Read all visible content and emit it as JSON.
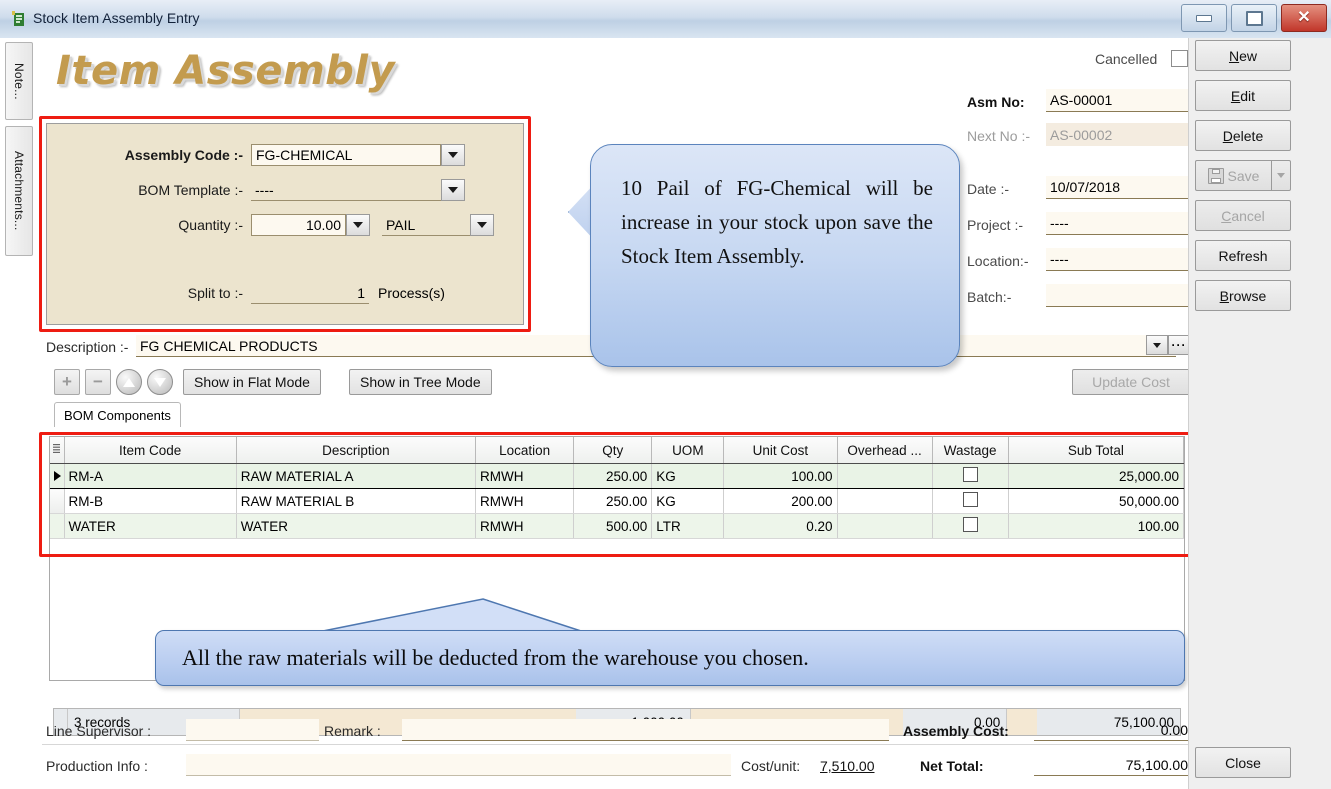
{
  "window": {
    "title": "Stock Item Assembly Entry",
    "icon": "app-icon",
    "minimize": "minimize-icon",
    "restore": "restore-icon",
    "close": "close-icon"
  },
  "side_tabs": [
    {
      "label": "Note...",
      "name": "note"
    },
    {
      "label": "Attachments...",
      "name": "attachments"
    }
  ],
  "page_title": "Item Assembly",
  "assembly_panel": {
    "assembly_code": {
      "label": "Assembly Code :-",
      "value": "FG-CHEMICAL"
    },
    "bom_template": {
      "label": "BOM Template :-",
      "value": "----"
    },
    "quantity": {
      "label": "Quantity :-",
      "value": "10.00",
      "uom": "PAIL"
    },
    "split_to": {
      "label": "Split to :-",
      "value": "1",
      "suffix": "Process(s)"
    }
  },
  "right_form": {
    "cancelled": {
      "label": "Cancelled",
      "checked": false
    },
    "asm_no": {
      "label": "Asm No:",
      "value": "AS-00001"
    },
    "next_no": {
      "label": "Next No :-",
      "value": "AS-00002"
    },
    "date": {
      "label": "Date :-",
      "value": "10/07/2018"
    },
    "project": {
      "label": "Project :-",
      "value": "----"
    },
    "location": {
      "label": "Location:-",
      "value": "----"
    },
    "batch": {
      "label": "Batch:-",
      "value": ""
    }
  },
  "buttons": {
    "new": "New",
    "edit": "Edit",
    "delete": "Delete",
    "save": "Save",
    "cancel": "Cancel",
    "refresh": "Refresh",
    "browse": "Browse",
    "close": "Close"
  },
  "description": {
    "label": "Description :-",
    "value": "FG CHEMICAL PRODUCTS"
  },
  "grid_toolbar": {
    "add": "+",
    "remove": "−",
    "move_up": "move-up",
    "move_down": "move-down",
    "flat_mode": "Show in Flat Mode",
    "tree_mode": "Show in Tree Mode",
    "update_cost": "Update Cost",
    "tab": "BOM Components"
  },
  "grid": {
    "columns": [
      "Item Code",
      "Description",
      "Location",
      "Qty",
      "UOM",
      "Unit Cost",
      "Overhead ...",
      "Wastage",
      "Sub Total"
    ],
    "rows": [
      {
        "item_code": "RM-A",
        "description": "RAW MATERIAL A",
        "location": "RMWH",
        "qty": "250.00",
        "uom": "KG",
        "unit_cost": "100.00",
        "overhead": "",
        "wastage": false,
        "sub_total": "25,000.00",
        "selected": true
      },
      {
        "item_code": "RM-B",
        "description": "RAW MATERIAL B",
        "location": "RMWH",
        "qty": "250.00",
        "uom": "KG",
        "unit_cost": "200.00",
        "overhead": "",
        "wastage": false,
        "sub_total": "50,000.00",
        "selected": false
      },
      {
        "item_code": "WATER",
        "description": "WATER",
        "location": "RMWH",
        "qty": "500.00",
        "uom": "LTR",
        "unit_cost": "0.20",
        "overhead": "",
        "wastage": false,
        "sub_total": "100.00",
        "selected": false
      }
    ],
    "summary": {
      "records": "3 records",
      "qty_total": "1,000.00",
      "overhead_total": "0.00",
      "sub_total": "75,100.00"
    }
  },
  "footer": {
    "line_supervisor": {
      "label": "Line Supervisor :",
      "value": ""
    },
    "remark": {
      "label": "Remark :",
      "value": ""
    },
    "production_info": {
      "label": "Production Info :",
      "value": ""
    },
    "cost_per_unit": {
      "label": "Cost/unit:",
      "value": "7,510.00"
    },
    "assembly_cost": {
      "label": "Assembly Cost:",
      "value": "0.00"
    },
    "net_total": {
      "label": "Net Total:",
      "value": "75,100.00"
    }
  },
  "callouts": {
    "one": "10 Pail of FG-Chemical will be increase in your stock upon save the Stock Item Assembly.",
    "two": "All the raw materials will be deducted from the warehouse you chosen."
  },
  "colors": {
    "highlight_border": "#ee1c12",
    "title_gold": "#c39b4e",
    "callout_blue": "#a9c3ea",
    "panel_beige": "#ece4ce"
  }
}
